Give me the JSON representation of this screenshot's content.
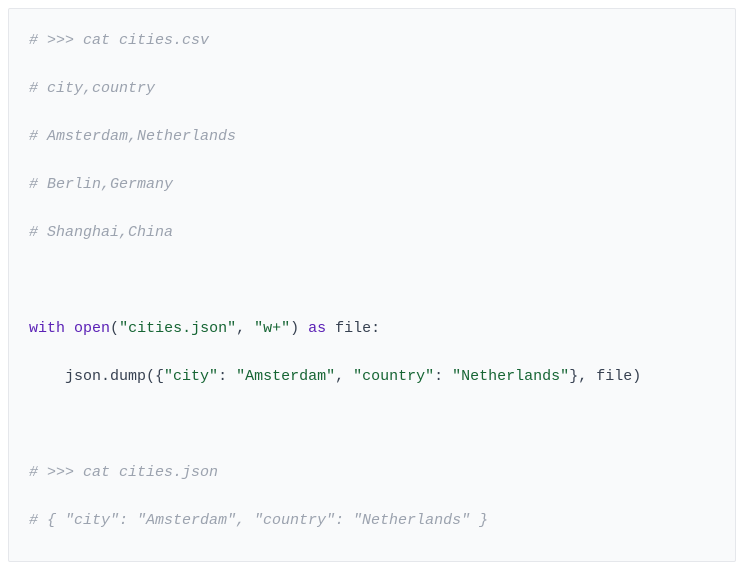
{
  "code": {
    "lines": [
      {
        "segments": [
          {
            "cls": "comment",
            "text": "# >>> cat cities.csv"
          }
        ]
      },
      {
        "spacer": true
      },
      {
        "segments": [
          {
            "cls": "comment",
            "text": "# city,country"
          }
        ]
      },
      {
        "spacer": true
      },
      {
        "segments": [
          {
            "cls": "comment",
            "text": "# Amsterdam,Netherlands"
          }
        ]
      },
      {
        "spacer": true
      },
      {
        "segments": [
          {
            "cls": "comment",
            "text": "# Berlin,Germany"
          }
        ]
      },
      {
        "spacer": true
      },
      {
        "segments": [
          {
            "cls": "comment",
            "text": "# Shanghai,China"
          }
        ]
      },
      {
        "spacer": true
      },
      {
        "spacer": true
      },
      {
        "spacer": true
      },
      {
        "segments": [
          {
            "cls": "keyword",
            "text": "with"
          },
          {
            "cls": "ident",
            "text": " "
          },
          {
            "cls": "builtin",
            "text": "open"
          },
          {
            "cls": "punct",
            "text": "("
          },
          {
            "cls": "string",
            "text": "\"cities.json\""
          },
          {
            "cls": "punct",
            "text": ", "
          },
          {
            "cls": "string",
            "text": "\"w+\""
          },
          {
            "cls": "punct",
            "text": ") "
          },
          {
            "cls": "keyword",
            "text": "as"
          },
          {
            "cls": "ident",
            "text": " file"
          },
          {
            "cls": "punct",
            "text": ":"
          }
        ]
      },
      {
        "spacer": true
      },
      {
        "segments": [
          {
            "cls": "ident",
            "text": "    json.dump({"
          },
          {
            "cls": "string",
            "text": "\"city\""
          },
          {
            "cls": "punct",
            "text": ": "
          },
          {
            "cls": "string",
            "text": "\"Amsterdam\""
          },
          {
            "cls": "punct",
            "text": ", "
          },
          {
            "cls": "string",
            "text": "\"country\""
          },
          {
            "cls": "punct",
            "text": ": "
          },
          {
            "cls": "string",
            "text": "\"Netherlands\""
          },
          {
            "cls": "punct",
            "text": "}, file)"
          }
        ]
      },
      {
        "spacer": true
      },
      {
        "spacer": true
      },
      {
        "spacer": true
      },
      {
        "segments": [
          {
            "cls": "comment",
            "text": "# >>> cat cities.json"
          }
        ]
      },
      {
        "spacer": true
      },
      {
        "segments": [
          {
            "cls": "comment",
            "text": "# { \"city\": \"Amsterdam\", \"country\": \"Netherlands\" }"
          }
        ]
      }
    ]
  }
}
